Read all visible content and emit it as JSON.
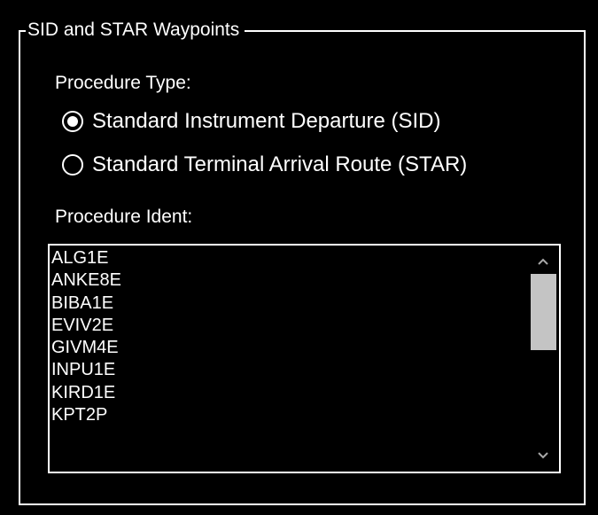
{
  "group": {
    "title": "SID and STAR Waypoints"
  },
  "procedure_type": {
    "label": "Procedure Type:",
    "options": [
      {
        "label": "Standard Instrument Departure (SID)",
        "selected": true
      },
      {
        "label": "Standard Terminal Arrival Route (STAR)",
        "selected": false
      }
    ]
  },
  "procedure_ident": {
    "label": "Procedure Ident:",
    "items": [
      "ALG1E",
      "ANKE8E",
      "BIBA1E",
      "EVIV2E",
      "GIVM4E",
      "INPU1E",
      "KIRD1E",
      "KPT2P"
    ]
  },
  "icons": {
    "scroll_up": "chevron-up-icon",
    "scroll_down": "chevron-down-icon"
  },
  "colors": {
    "background": "#000000",
    "foreground": "#ffffff",
    "scroll_thumb": "#c4c4c4",
    "scroll_arrow": "#a8a8a8"
  }
}
